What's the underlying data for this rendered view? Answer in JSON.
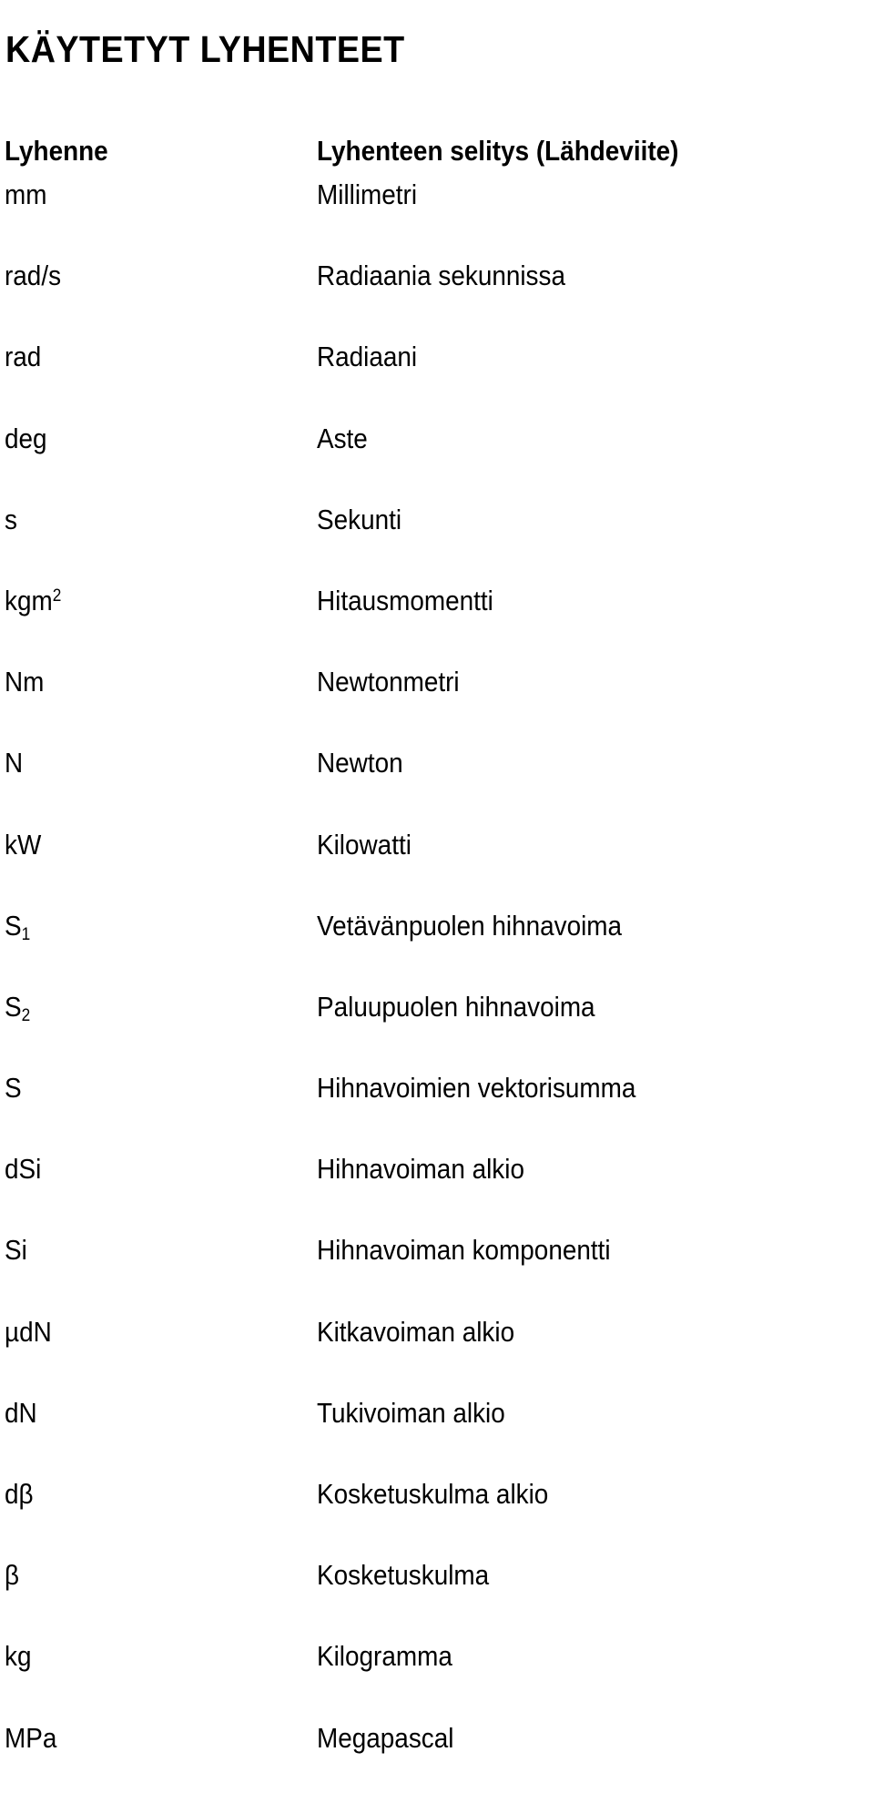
{
  "document": {
    "title": "KÄYTETYT LYHENTEET"
  },
  "table": {
    "headers": {
      "abbreviation": "Lyhenne",
      "explanation": "Lyhenteen selitys (Lähdeviite)"
    },
    "rows": [
      {
        "abbr": "mm",
        "abbr_sub": "",
        "abbr_sup": "",
        "desc": "Millimetri"
      },
      {
        "abbr": "rad/s",
        "abbr_sub": "",
        "abbr_sup": "",
        "desc": "Radiaania sekunnissa"
      },
      {
        "abbr": "rad",
        "abbr_sub": "",
        "abbr_sup": "",
        "desc": "Radiaani"
      },
      {
        "abbr": "deg",
        "abbr_sub": "",
        "abbr_sup": "",
        "desc": "Aste"
      },
      {
        "abbr": "s",
        "abbr_sub": "",
        "abbr_sup": "",
        "desc": "Sekunti"
      },
      {
        "abbr": "kgm",
        "abbr_sub": "",
        "abbr_sup": "2",
        "desc": "Hitausmomentti"
      },
      {
        "abbr": "Nm",
        "abbr_sub": "",
        "abbr_sup": "",
        "desc": "Newtonmetri"
      },
      {
        "abbr": "N",
        "abbr_sub": "",
        "abbr_sup": "",
        "desc": "Newton"
      },
      {
        "abbr": "kW",
        "abbr_sub": "",
        "abbr_sup": "",
        "desc": "Kilowatti"
      },
      {
        "abbr": "S",
        "abbr_sub": "1",
        "abbr_sup": "",
        "desc": "Vetävänpuolen hihnavoima"
      },
      {
        "abbr": "S",
        "abbr_sub": "2",
        "abbr_sup": "",
        "desc": "Paluupuolen hihnavoima"
      },
      {
        "abbr": "S",
        "abbr_sub": "",
        "abbr_sup": "",
        "desc": "Hihnavoimien vektorisumma"
      },
      {
        "abbr": "dSi",
        "abbr_sub": "",
        "abbr_sup": "",
        "desc": "Hihnavoiman alkio"
      },
      {
        "abbr": "Si",
        "abbr_sub": "",
        "abbr_sup": "",
        "desc": "Hihnavoiman komponentti"
      },
      {
        "abbr": "µdN",
        "abbr_sub": "",
        "abbr_sup": "",
        "desc": "Kitkavoiman alkio"
      },
      {
        "abbr": "dN",
        "abbr_sub": "",
        "abbr_sup": "",
        "desc": "Tukivoiman alkio"
      },
      {
        "abbr": "dβ",
        "abbr_sub": "",
        "abbr_sup": "",
        "desc": "Kosketuskulma alkio"
      },
      {
        "abbr": "β",
        "abbr_sub": "",
        "abbr_sup": "",
        "desc": "Kosketuskulma"
      },
      {
        "abbr": "kg",
        "abbr_sub": "",
        "abbr_sup": "",
        "desc": "Kilogramma"
      },
      {
        "abbr": "MPa",
        "abbr_sub": "",
        "abbr_sup": "",
        "desc": "Megapascal"
      }
    ]
  },
  "colors": {
    "text": "#000000",
    "background": "#ffffff"
  }
}
